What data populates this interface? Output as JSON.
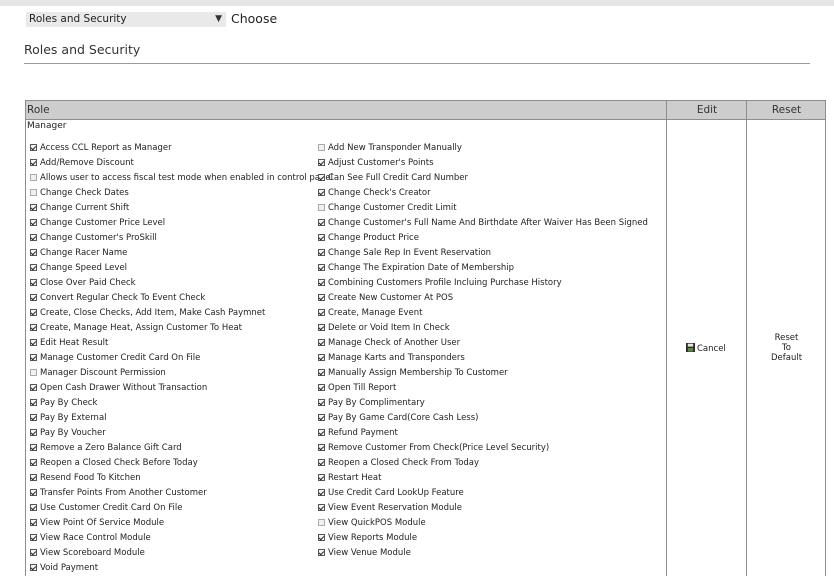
{
  "toolbar": {
    "role_select_value": "Roles and Security",
    "choose_label": "Choose"
  },
  "page": {
    "title": "Roles and Security"
  },
  "grid": {
    "headers": {
      "role": "Role",
      "edit": "Edit",
      "reset": "Reset"
    },
    "role_name": "Manager",
    "actions": {
      "cancel_label": "Cancel",
      "reset_line1": "Reset",
      "reset_line2": "To",
      "reset_line3": "Default"
    },
    "left_permissions": [
      {
        "label": "Access CCL Report as Manager",
        "checked": true
      },
      {
        "label": "Add/Remove Discount",
        "checked": true
      },
      {
        "label": "Allows user to access fiscal test mode when enabled in control panel",
        "checked": false
      },
      {
        "label": "Change Check Dates",
        "checked": false
      },
      {
        "label": "Change Current Shift",
        "checked": true
      },
      {
        "label": "Change Customer Price Level",
        "checked": true
      },
      {
        "label": "Change Customer's ProSkill",
        "checked": true
      },
      {
        "label": "Change Racer Name",
        "checked": true
      },
      {
        "label": "Change Speed Level",
        "checked": true
      },
      {
        "label": "Close Over Paid Check",
        "checked": true
      },
      {
        "label": "Convert Regular Check To Event Check",
        "checked": true
      },
      {
        "label": "Create, Close Checks, Add Item, Make Cash Paymnet",
        "checked": true
      },
      {
        "label": "Create, Manage Heat, Assign Customer To Heat",
        "checked": true
      },
      {
        "label": "Edit Heat Result",
        "checked": true
      },
      {
        "label": "Manage Customer Credit Card On File",
        "checked": true
      },
      {
        "label": "Manager Discount Permission",
        "checked": false
      },
      {
        "label": "Open Cash Drawer Without Transaction",
        "checked": true
      },
      {
        "label": "Pay By Check",
        "checked": true
      },
      {
        "label": "Pay By External",
        "checked": true
      },
      {
        "label": "Pay By Voucher",
        "checked": true
      },
      {
        "label": "Remove a Zero Balance Gift Card",
        "checked": true
      },
      {
        "label": "Reopen a Closed Check Before Today",
        "checked": true
      },
      {
        "label": "Resend Food To Kitchen",
        "checked": true
      },
      {
        "label": "Transfer Points From Another Customer",
        "checked": true
      },
      {
        "label": "Use Customer Credit Card On File",
        "checked": true
      },
      {
        "label": "View Point Of Service Module",
        "checked": true
      },
      {
        "label": "View Race Control Module",
        "checked": true
      },
      {
        "label": "View Scoreboard Module",
        "checked": true
      },
      {
        "label": "Void Payment",
        "checked": true
      }
    ],
    "right_permissions": [
      {
        "label": "Add New Transponder Manually",
        "checked": false
      },
      {
        "label": "Adjust Customer's Points",
        "checked": true
      },
      {
        "label": "Can See Full Credit Card Number",
        "checked": true
      },
      {
        "label": "Change Check's Creator",
        "checked": true
      },
      {
        "label": "Change Customer Credit Limit",
        "checked": false
      },
      {
        "label": "Change Customer's Full Name And Birthdate After Waiver Has Been Signed",
        "checked": true
      },
      {
        "label": "Change Product Price",
        "checked": true
      },
      {
        "label": "Change Sale Rep In Event Reservation",
        "checked": true
      },
      {
        "label": "Change The Expiration Date of Membership",
        "checked": true
      },
      {
        "label": "Combining Customers Profile Incluing Purchase History",
        "checked": true
      },
      {
        "label": "Create New Customer At POS",
        "checked": true
      },
      {
        "label": "Create, Manage Event",
        "checked": true
      },
      {
        "label": "Delete or Void Item In Check",
        "checked": true
      },
      {
        "label": "Manage Check of Another User",
        "checked": true
      },
      {
        "label": "Manage Karts and Transponders",
        "checked": true
      },
      {
        "label": "Manually Assign Membership To Customer",
        "checked": true
      },
      {
        "label": "Open Till Report",
        "checked": true
      },
      {
        "label": "Pay By Complimentary",
        "checked": true
      },
      {
        "label": "Pay By Game Card(Core Cash Less)",
        "checked": true
      },
      {
        "label": "Refund Payment",
        "checked": true
      },
      {
        "label": "Remove Customer From Check(Price Level Security)",
        "checked": true
      },
      {
        "label": "Reopen a Closed Check From Today",
        "checked": true
      },
      {
        "label": "Restart Heat",
        "checked": true
      },
      {
        "label": "Use Credit Card LookUp Feature",
        "checked": true
      },
      {
        "label": "View Event Reservation Module",
        "checked": true
      },
      {
        "label": "View QuickPOS Module",
        "checked": false
      },
      {
        "label": "View Reports Module",
        "checked": true
      },
      {
        "label": "View Venue Module",
        "checked": true
      }
    ]
  }
}
